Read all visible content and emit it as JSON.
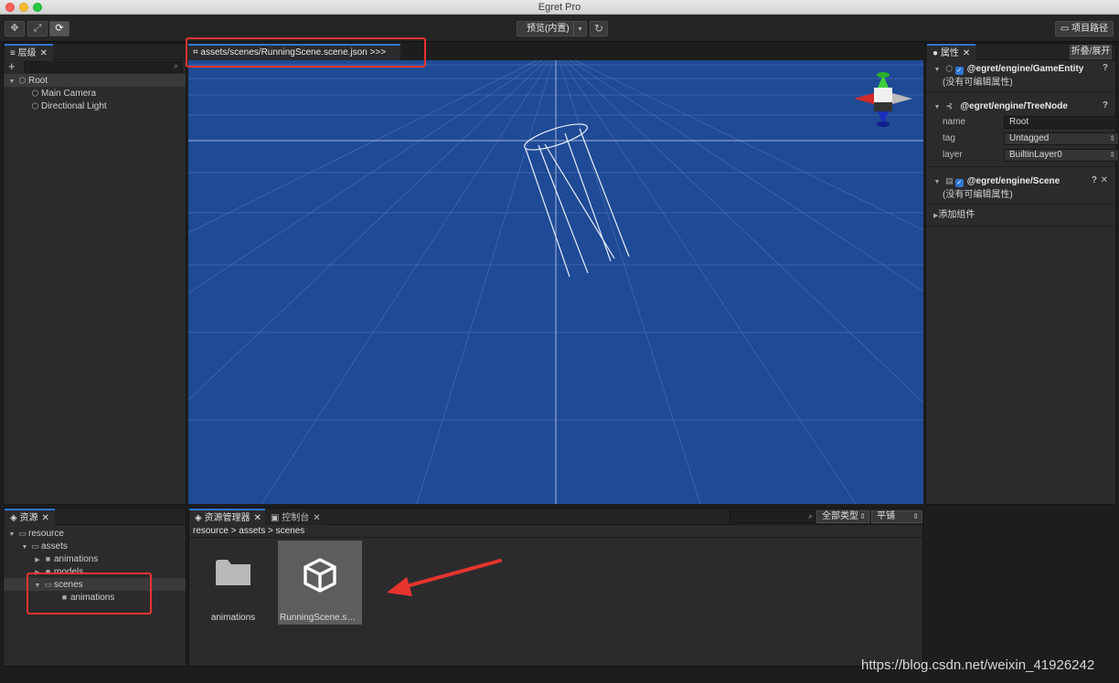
{
  "window": {
    "title": "Egret Pro"
  },
  "toolbar": {
    "move_icon": "✥",
    "scale_icon": "⤢",
    "rotate_icon": "⟳",
    "preview_label": "预览(内置)",
    "preview_caret": "▾",
    "refresh_icon": "↻",
    "project_path_label": "项目路径"
  },
  "hierarchy": {
    "tab_label": "层级",
    "close": "✕",
    "add": "+",
    "items": [
      {
        "label": "Root"
      },
      {
        "label": "Main Camera"
      },
      {
        "label": "Directional Light"
      }
    ]
  },
  "scene": {
    "tab_label": "assets/scenes/RunningScene.scene.json  >>>"
  },
  "properties": {
    "tab_label": "属性",
    "close": "✕",
    "fold_label": "折叠/展开",
    "components": [
      {
        "name": "@egret/engine/GameEntity",
        "note": "(没有可编辑属性)"
      },
      {
        "name": "@egret/engine/TreeNode",
        "fields": [
          {
            "label": "name",
            "value": "Root"
          },
          {
            "label": "tag",
            "value": "Untagged"
          },
          {
            "label": "layer",
            "value": "BuiltinLayer0"
          }
        ]
      },
      {
        "name": "@egret/engine/Scene",
        "note": "(没有可编辑属性)"
      }
    ],
    "add_component": "添加组件",
    "help": "?"
  },
  "resources": {
    "tab_label": "资源",
    "close": "✕",
    "tree": [
      {
        "label": "resource"
      },
      {
        "label": "assets"
      },
      {
        "label": "animations"
      },
      {
        "label": "models"
      },
      {
        "label": "scenes"
      },
      {
        "label": "animations"
      }
    ]
  },
  "asset_manager": {
    "tab_label": "资源管理器",
    "console_tab_label": "控制台",
    "close": "✕",
    "type_filter": "全部类型",
    "view_mode": "平铺",
    "breadcrumb": "resource  >  assets  >  scenes",
    "items": [
      {
        "label": "animations"
      },
      {
        "label": "RunningScene.sce..."
      }
    ]
  },
  "watermark": "https://blog.csdn.net/weixin_41926242",
  "colors": {
    "accent": "#2f76d1",
    "scene_bg": "#1f4a95",
    "annotation": "#e8342e"
  }
}
